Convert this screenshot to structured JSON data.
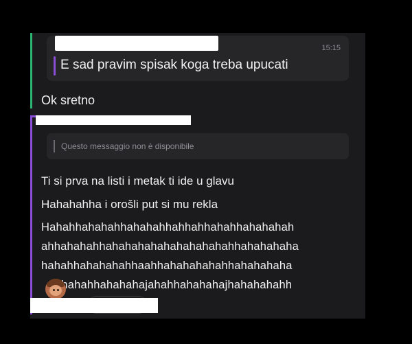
{
  "quoted": {
    "time": "15:15",
    "text": "E sad pravim spisak koga treba upucati"
  },
  "reply": "Ok sretno",
  "unavailable": "Questo messaggio non è disponibile",
  "messages": [
    "Ti si prva na listi i metak ti ide u glavu",
    "Hahahahha i orošli put si mu rekla"
  ],
  "laugh_lines": [
    "Hahahhahahahhahahahhahhahhahahhahahahah",
    "ahhahahahhahahahahahahahahahahhahahahaha",
    "hahahhahahahahhaahhahahahahahhahahahaha",
    "ahahahhahahahajahahhahahahajhahahahahh"
  ],
  "colors": {
    "background": "#000000",
    "panel": "#1b1b1d",
    "card": "#262628",
    "accent_green": "#2bb673",
    "accent_purple": "#8a4fd6"
  },
  "icons": {
    "avatar": "user-avatar-emoji"
  }
}
